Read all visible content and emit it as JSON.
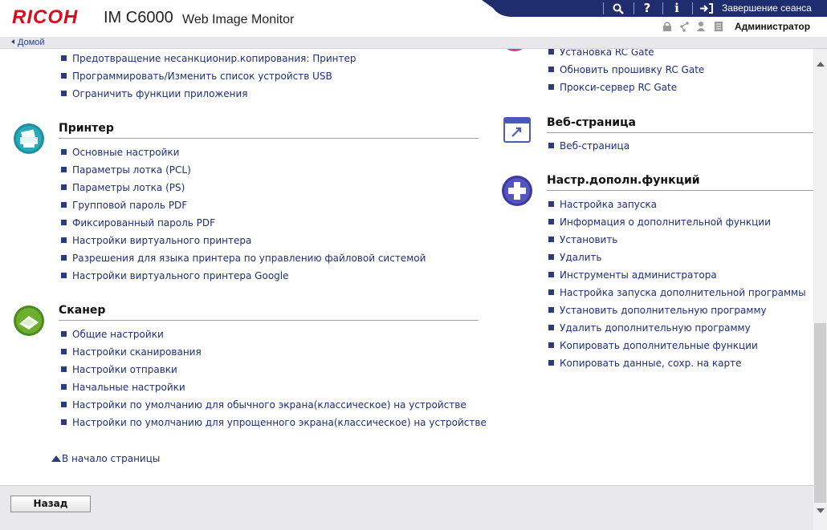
{
  "header": {
    "logo": "RICOH",
    "model": "IM C6000",
    "app_title": "Web Image Monitor",
    "logout_label": "Завершение сеанса",
    "user_role": "Администратор"
  },
  "breadcrumb": {
    "home_label": "Домой"
  },
  "left_column": {
    "top_links": [
      "Предотвращение несанкционир.копирования: Принтер",
      "Программировать/Изменить список устройств USB",
      "Ограничить функции приложения"
    ],
    "printer": {
      "title": "Принтер",
      "links": [
        "Основные настройки",
        "Параметры лотка (PCL)",
        "Параметры лотка (PS)",
        "Групповой пароль PDF",
        "Фиксированный пароль PDF",
        "Настройки виртуального принтера",
        "Разрешения для языка принтера по управлению файловой системой",
        "Настройки виртуального принтера Google"
      ]
    },
    "scanner": {
      "title": "Сканер",
      "links": [
        "Общие настройки",
        "Настройки сканирования",
        "Настройки отправки",
        "Начальные настройки",
        "Настройки по умолчанию для обычного экрана(классическое) на устройстве",
        "Настройки по умолчанию для упрощенного экрана(классическое) на устройстве"
      ]
    },
    "back_to_top": "В начало страницы"
  },
  "right_column": {
    "rcgate_links": [
      "Установка RC Gate",
      "Обновить прошивку RC Gate",
      "Прокси-сервер RC Gate"
    ],
    "webpage": {
      "title": "Веб-страница",
      "links": [
        "Веб-страница"
      ]
    },
    "extended": {
      "title": "Настр.дополн.функций",
      "links": [
        "Настройка запуска",
        "Информация о дополнительной функции",
        "Установить",
        "Удалить",
        "Инструменты администратора",
        "Настройка запуска дополнительной программы",
        "Установить дополнительную программу",
        "Удалить дополнительную программу",
        "Копировать дополнительные функции",
        "Копировать данные, сохр. на карте"
      ]
    }
  },
  "footer": {
    "back_label": "Назад"
  },
  "colors": {
    "brand_red": "#d60d1b",
    "link_blue": "#1d2f78",
    "topbar_navy": "#1f2d6e"
  }
}
